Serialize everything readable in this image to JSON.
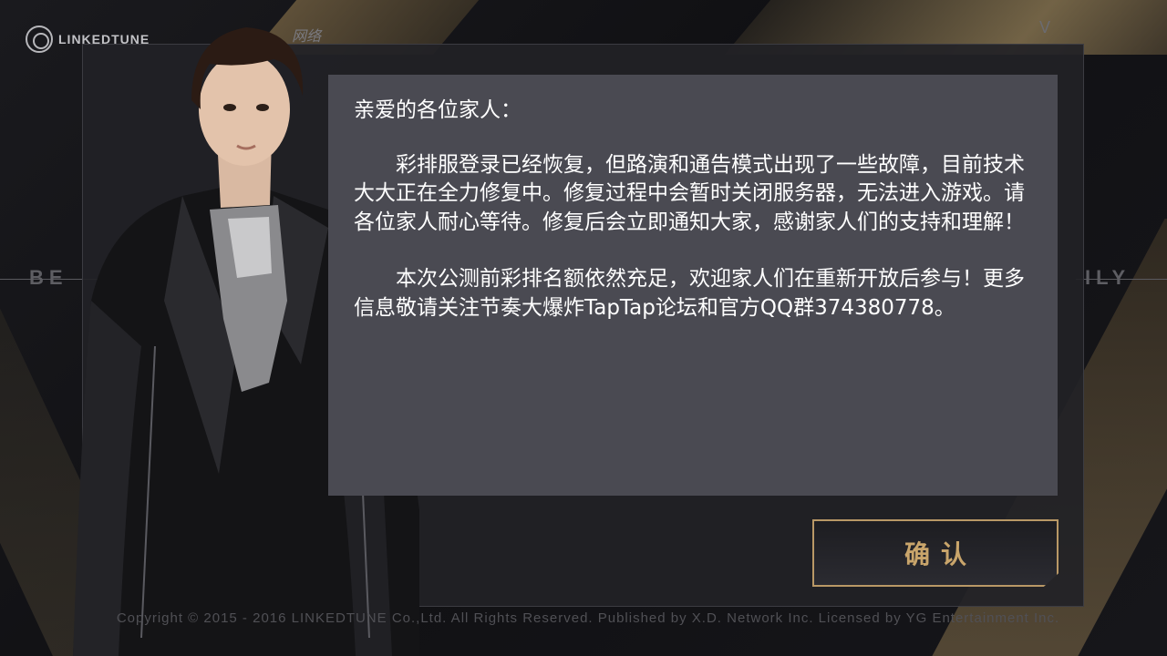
{
  "logo": {
    "name": "LINKEDTUNE"
  },
  "top_label": "网络",
  "version_text": "V",
  "side_left_text": "BE",
  "side_right_text": "ILY",
  "notice": {
    "greeting": "亲爱的各位家人：",
    "paragraph1": "彩排服登录已经恢复，但路演和通告模式出现了一些故障，目前技术大大正在全力修复中。修复过程中会暂时关闭服务器，无法进入游戏。请各位家人耐心等待。修复后会立即通知大家，感谢家人们的支持和理解！",
    "paragraph2": "本次公测前彩排名额依然充足，欢迎家人们在重新开放后参与！更多信息敬请关注节奏大爆炸TapTap论坛和官方QQ群374380778。"
  },
  "confirm_label": "确认",
  "copyright": "Copyright © 2015 - 2016 LINKEDTUNE Co.,Ltd. All Rights Reserved. Published by X.D. Network Inc. Licensed by YG Entertainment Inc.",
  "colors": {
    "accent_gold": "#c9a56b",
    "notice_bg": "#4a4a52",
    "dialog_bg": "#222226"
  },
  "icons": {
    "logo": "linkedtune-logo-icon"
  }
}
